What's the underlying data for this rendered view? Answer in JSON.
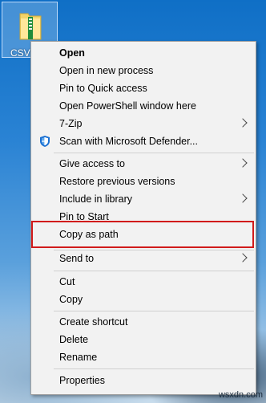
{
  "desktop": {
    "icon_label": "CSV F"
  },
  "menu": {
    "items": [
      {
        "label": "Open",
        "bold": true
      },
      {
        "label": "Open in new process"
      },
      {
        "label": "Pin to Quick access"
      },
      {
        "label": "Open PowerShell window here"
      },
      {
        "label": "7-Zip",
        "submenu": true
      },
      {
        "label": "Scan with Microsoft Defender...",
        "icon": "shield-icon"
      },
      {
        "label": "Give access to",
        "submenu": true
      },
      {
        "label": "Restore previous versions"
      },
      {
        "label": "Include in library",
        "submenu": true
      },
      {
        "label": "Pin to Start"
      },
      {
        "label": "Copy as path",
        "highlighted": true
      },
      {
        "label": "Send to",
        "submenu": true
      },
      {
        "label": "Cut"
      },
      {
        "label": "Copy"
      },
      {
        "label": "Create shortcut"
      },
      {
        "label": "Delete"
      },
      {
        "label": "Rename"
      },
      {
        "label": "Properties"
      }
    ],
    "highlight_color": "#d11b1b"
  },
  "watermark": "wsxdn.com"
}
